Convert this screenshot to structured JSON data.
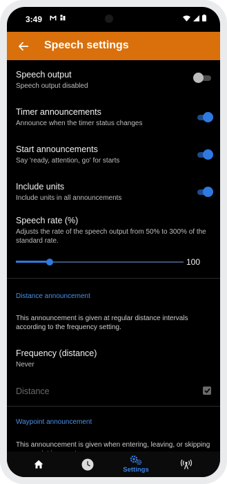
{
  "status_bar": {
    "time": "3:49",
    "icons_left": [
      "gmail-icon",
      "data-saver-icon"
    ],
    "icons_right": [
      "wifi-icon",
      "signal-icon",
      "battery-icon"
    ]
  },
  "app_bar": {
    "title": "Speech settings",
    "background": "#d9700c"
  },
  "settings": [
    {
      "title": "Speech output",
      "subtitle": "Speech output disabled",
      "enabled": false
    },
    {
      "title": "Timer announcements",
      "subtitle": "Announce when the timer status changes",
      "enabled": true
    },
    {
      "title": "Start announcements",
      "subtitle": "Say 'ready, attention, go' for starts",
      "enabled": true
    },
    {
      "title": "Include units",
      "subtitle": "Include units in all announcements",
      "enabled": true
    }
  ],
  "speech_rate": {
    "title": "Speech rate (%)",
    "description": "Adjusts the rate of the speech output from 50% to 300% of the standard rate.",
    "value": "100",
    "min": 50,
    "max": 300,
    "current": 100
  },
  "distance_section": {
    "header": "Distance announcement",
    "description": "This announcement is given at regular distance intervals according to the frequency setting.",
    "frequency_title": "Frequency (distance)",
    "frequency_value": "Never",
    "distance_label": "Distance",
    "distance_checked": true
  },
  "waypoint_section": {
    "header": "Waypoint announcement",
    "description": "This announcement is given when entering, leaving, or skipping a waypoint in a custom course."
  },
  "bottom_nav": {
    "items": [
      {
        "icon": "home-icon",
        "label": ""
      },
      {
        "icon": "clock-icon",
        "label": ""
      },
      {
        "icon": "settings-icon",
        "label": "Settings",
        "active": true
      },
      {
        "icon": "broadcast-icon",
        "label": ""
      }
    ]
  },
  "colors": {
    "accent": "#2e7ae0",
    "section_header": "#4c8fe6",
    "app_bar": "#d9700c"
  }
}
